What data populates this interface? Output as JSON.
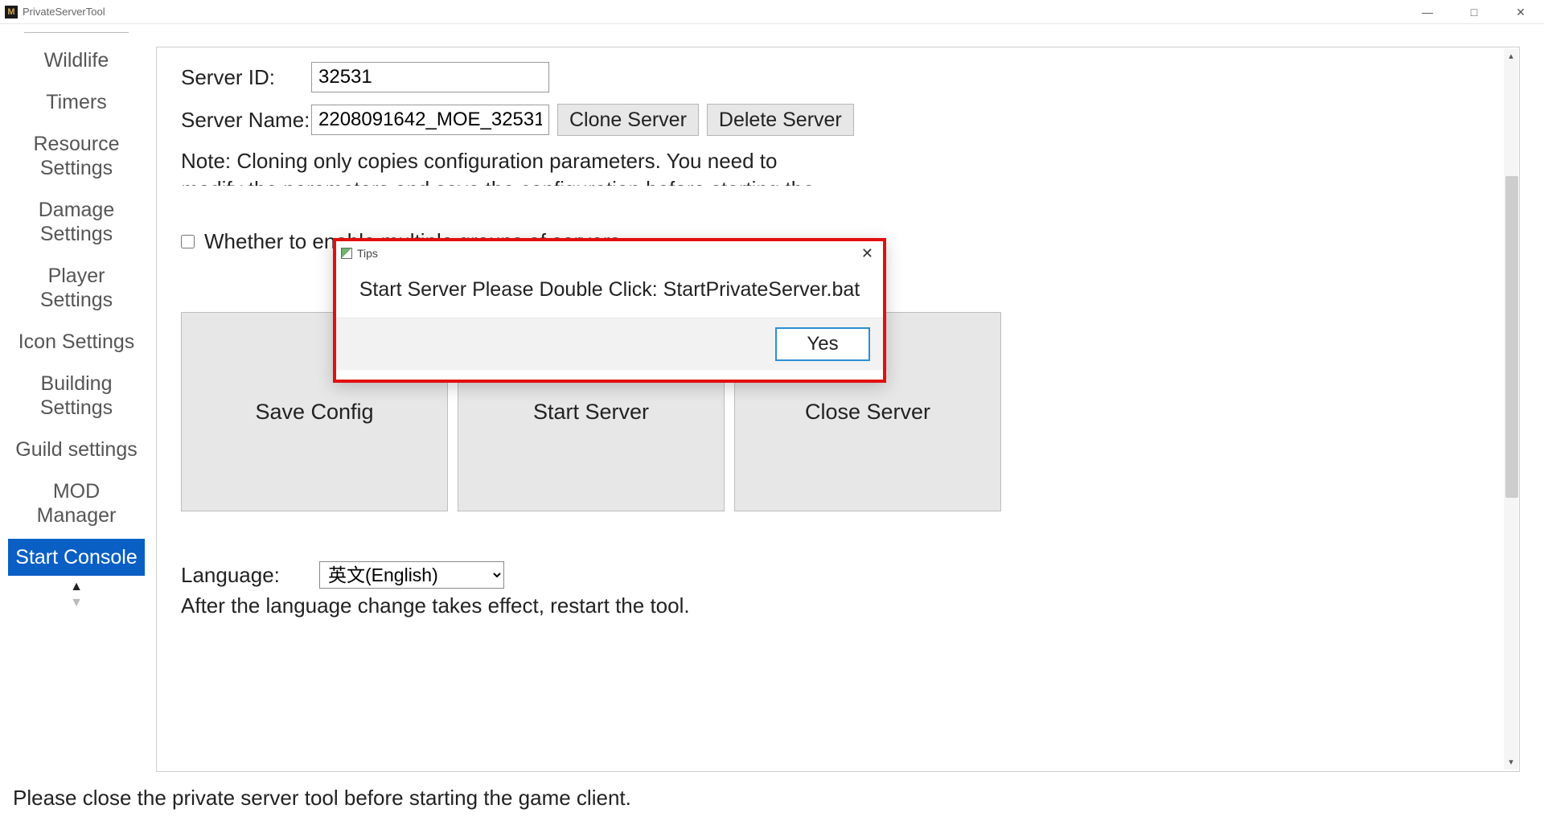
{
  "window": {
    "title": "PrivateServerTool"
  },
  "sidebar": {
    "items": [
      {
        "label": "Wildlife"
      },
      {
        "label": "Timers"
      },
      {
        "label": "Resource Settings"
      },
      {
        "label": "Damage Settings"
      },
      {
        "label": "Player Settings"
      },
      {
        "label": "Icon Settings"
      },
      {
        "label": "Building Settings"
      },
      {
        "label": "Guild settings"
      },
      {
        "label": "MOD Manager"
      },
      {
        "label": "Start Console"
      }
    ],
    "active_index": 9
  },
  "form": {
    "server_id_label": "Server ID:",
    "server_id_value": "32531",
    "server_name_label": "Server Name:",
    "server_name_value": "2208091642_MOE_32531",
    "clone_label": "Clone Server",
    "delete_label": "Delete Server",
    "note": "Note: Cloning only copies configuration parameters. You need to modify the parameters and save the configuration before starting the",
    "multi_group_label": "Whether to enable multiple groups of servers",
    "multi_group_checked": false
  },
  "big_buttons": {
    "save": "Save Config",
    "start": "Start Server",
    "close": "Close Server"
  },
  "language": {
    "label": "Language:",
    "selected": "英文(English)",
    "note": "After the language change takes effect, restart the tool."
  },
  "statusbar": "Please close the private server tool before starting the game client.",
  "dialog": {
    "title": "Tips",
    "message": "Start Server Please Double Click: StartPrivateServer.bat",
    "yes_label": "Yes"
  }
}
